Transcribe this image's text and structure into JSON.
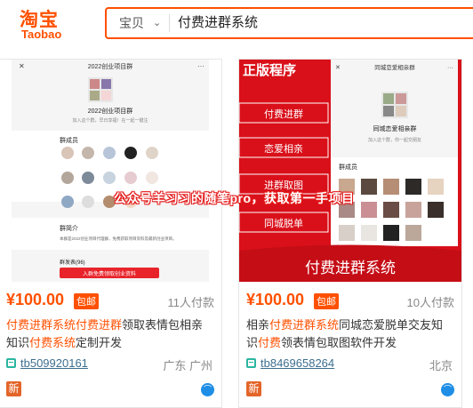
{
  "logo": {
    "cn": "淘宝",
    "en": "Taobao"
  },
  "search": {
    "category": "宝贝",
    "query": "付费进群系统"
  },
  "watermark": "公众号羊习习的随笔pro，获取第一手项目",
  "colors": {
    "accent": "#ff5000",
    "banner_red": "#d9101a",
    "link": "#3c6e8f"
  },
  "products": [
    {
      "image": {
        "top_title": "2022创业项目群",
        "group_name": "2022创业项目群",
        "group_sub": "加入这个群，早日享福！在一起一键注",
        "members_label": "群成员",
        "intro_label": "群简介",
        "intro_text": "本群是2022创业项目代理群，免费获取项目资料及最新创业项目。",
        "notice_label": "群发表(96)",
        "join_button": "入群免费领取创业资料"
      },
      "price": "¥100.00",
      "baoyou": "包邮",
      "sold": "11人付款",
      "title_parts": [
        {
          "text": "付费进群系统付费进群",
          "hl": true
        },
        {
          "text": "领取表情包相亲知识",
          "hl": false
        },
        {
          "text": "付费系统",
          "hl": true
        },
        {
          "text": "定制开发",
          "hl": false
        }
      ],
      "shop": "tb509920161",
      "location": "广东 广州",
      "new_badge": "新",
      "ww": "⌒"
    },
    {
      "image": {
        "corner_label": "正版程序",
        "top_title": "同城恋爱相亲群",
        "group_name": "同城恋爱相亲群",
        "group_sub": "加入这个群，你一起交朋友",
        "members_label": "群成员",
        "tags": [
          "付费进群",
          "恋爱相亲",
          "进群取图",
          "同城脱单"
        ],
        "banner": "付费进群系统"
      },
      "price": "¥100.00",
      "baoyou": "包邮",
      "sold": "10人付款",
      "title_parts": [
        {
          "text": "相亲",
          "hl": false
        },
        {
          "text": "付费进群系统",
          "hl": true
        },
        {
          "text": "同城恋爱脱单交友知识",
          "hl": false
        },
        {
          "text": "付费",
          "hl": true
        },
        {
          "text": "领表情包取图软件开发",
          "hl": false
        }
      ],
      "shop": "tb8469658264",
      "location": "北京",
      "new_badge": "新",
      "ww": "⌒"
    }
  ]
}
